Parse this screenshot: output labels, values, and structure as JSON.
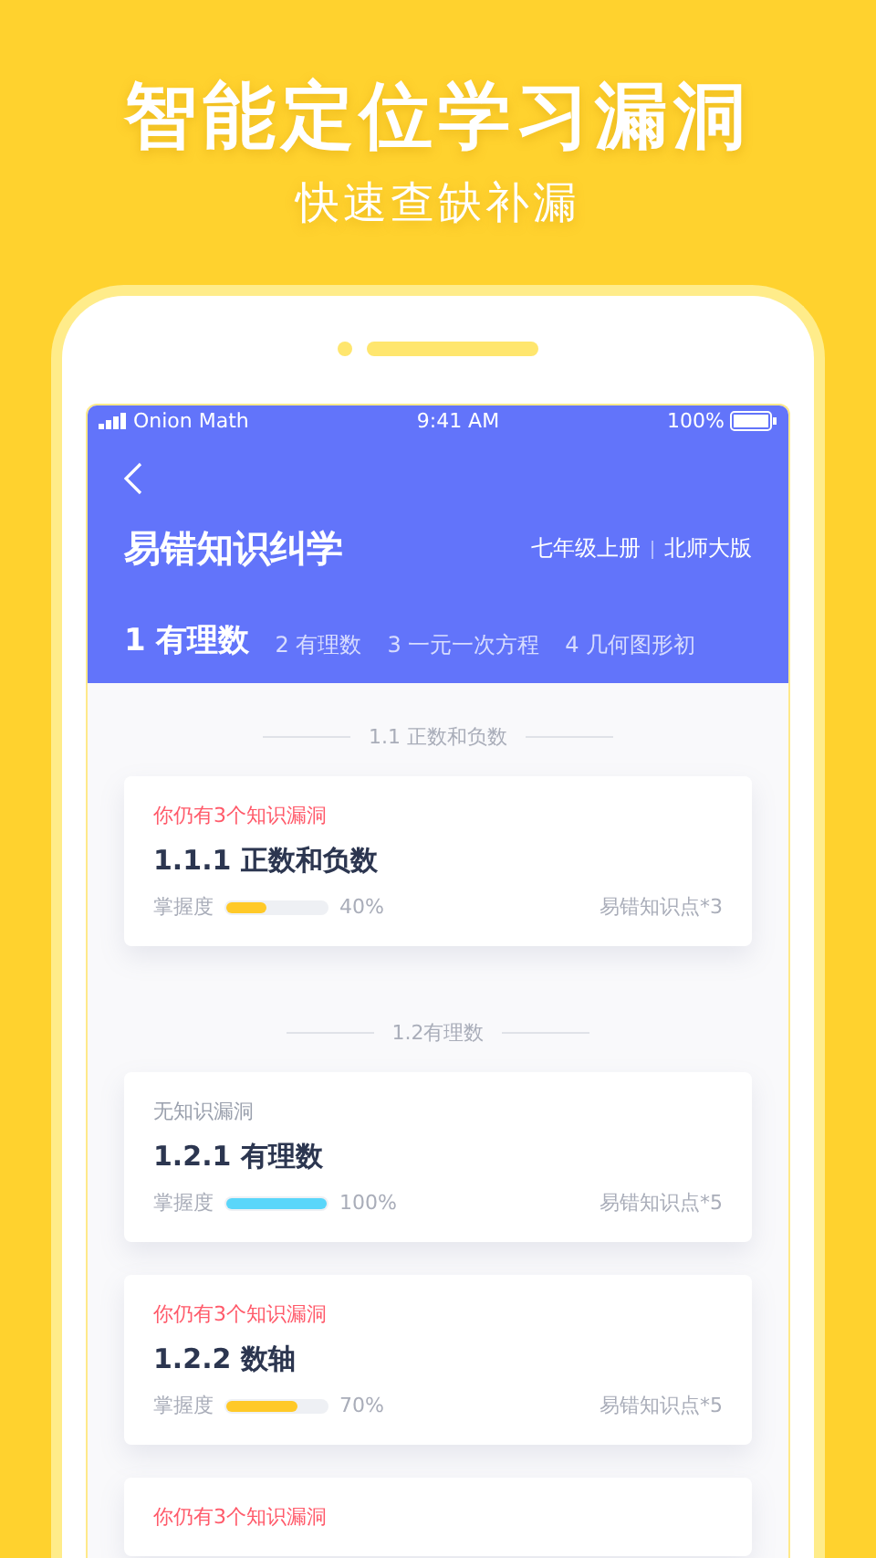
{
  "headline": "智能定位学习漏洞",
  "subheadline": "快速查缺补漏",
  "status_bar": {
    "carrier": "Onion Math",
    "time": "9:41 AM",
    "battery": "100%"
  },
  "header": {
    "title": "易错知识纠学",
    "grade": "七年级上册",
    "edition": "北师大版"
  },
  "tabs": [
    {
      "label": "1 有理数",
      "selected": true
    },
    {
      "label": "2 有理数",
      "selected": false
    },
    {
      "label": "3 一元一次方程",
      "selected": false
    },
    {
      "label": "4 几何图形初",
      "selected": false
    }
  ],
  "sections": [
    {
      "heading": "1.1 正数和负数",
      "cards": [
        {
          "status": "你仍有3个知识漏洞",
          "has_gaps": true,
          "title": "1.1.1 正数和负数",
          "mastery_label": "掌握度",
          "level": 0.4,
          "percent": "40%",
          "errors": "易错知识点*3"
        }
      ]
    },
    {
      "heading": "1.2有理数",
      "cards": [
        {
          "status": "无知识漏洞",
          "has_gaps": false,
          "title": "1.2.1 有理数",
          "mastery_label": "掌握度",
          "level": 1,
          "percent": "100%",
          "errors": "易错知识点*5"
        },
        {
          "status": "你仍有3个知识漏洞",
          "has_gaps": true,
          "title": "1.2.2 数轴",
          "mastery_label": "掌握度",
          "level": 0.7,
          "percent": "70%",
          "errors": "易错知识点*5"
        },
        {
          "status": "你仍有3个知识漏洞",
          "has_gaps": true
        }
      ]
    }
  ]
}
